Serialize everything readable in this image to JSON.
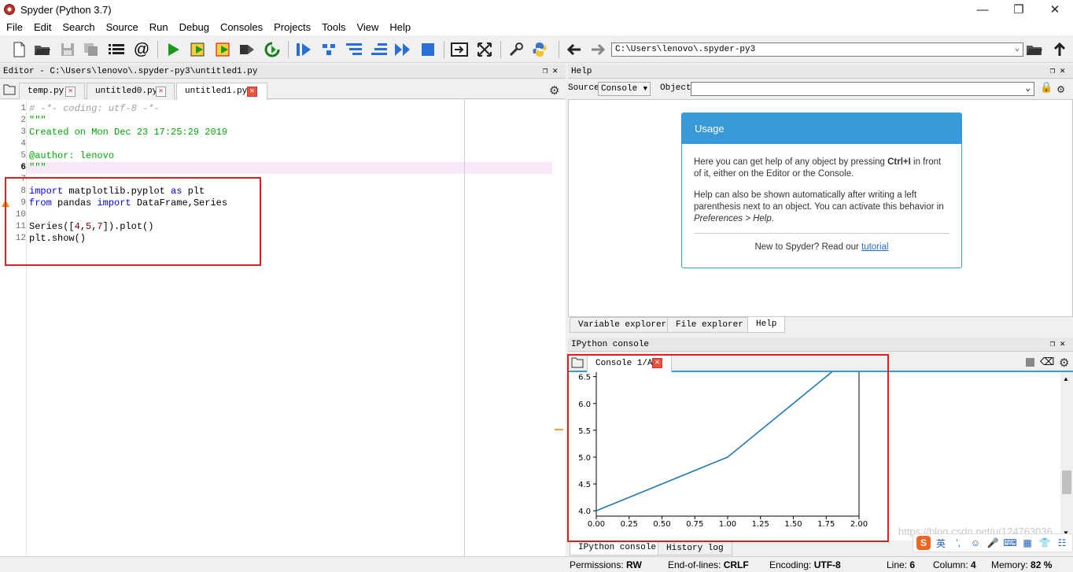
{
  "window": {
    "title": "Spyder (Python 3.7)"
  },
  "menu": [
    "File",
    "Edit",
    "Search",
    "Source",
    "Run",
    "Debug",
    "Consoles",
    "Projects",
    "Tools",
    "View",
    "Help"
  ],
  "toolbar": {
    "working_dir": "C:\\Users\\lenovo\\.spyder-py3"
  },
  "editor": {
    "pane_title": "Editor - C:\\Users\\lenovo\\.spyder-py3\\untitled1.py",
    "tabs": [
      "temp.py",
      "untitled0.py",
      "untitled1.py"
    ],
    "active_tab": "untitled1.py",
    "line_numbers": [
      "1",
      "2",
      "3",
      "4",
      "5",
      "6",
      "7",
      "8",
      "9",
      "10",
      "11",
      "12"
    ],
    "current_line": "6",
    "code": {
      "l1": "# -*- coding: utf-8 -*-",
      "l2": "\"\"\"",
      "l3": "Created on Mon Dec 23 17:25:29 2019",
      "l5": "@author: lenovo",
      "l6": "\"\"\"",
      "l8_kw1": "import",
      "l8_mod": " matplotlib.pyplot ",
      "l8_kw2": "as",
      "l8_rest": " plt",
      "l9_kw1": "from",
      "l9_mod": " pandas ",
      "l9_kw2": "import",
      "l9_rest": " DataFrame,Series",
      "l11_a": "Series([",
      "l11_n1": "4",
      "l11_c1": ",",
      "l11_n2": "5",
      "l11_c2": ",",
      "l11_n3": "7",
      "l11_b": "]).plot()",
      "l12": "plt.show()"
    }
  },
  "help": {
    "pane_title": "Help",
    "source_label": "Source",
    "source_value": "Console",
    "object_label": "Object",
    "usage_title": "Usage",
    "p1a": "Here you can get help of any object by pressing ",
    "p1b": "Ctrl+I",
    "p1c": " in front of it, either on the Editor or the Console.",
    "p2a": "Help can also be shown automatically after writing a left parenthesis next to an object. You can activate this behavior in ",
    "p2b": "Preferences > Help",
    "p2c": ".",
    "new_text": "New to Spyder? Read our ",
    "tutorial_link": "tutorial",
    "tabs": [
      "Variable explorer",
      "File explorer",
      "Help"
    ]
  },
  "console": {
    "pane_title": "IPython console",
    "tab": "Console 1/A",
    "bottom_tabs": [
      "IPython console",
      "History log"
    ],
    "watermark": "https://blog.csdn.net/u/124763036"
  },
  "chart_data": {
    "type": "line",
    "title": "",
    "xlabel": "",
    "ylabel": "",
    "x": [
      0,
      1,
      2
    ],
    "series": [
      {
        "values": [
          4,
          5,
          7
        ],
        "color": "#1f77b4"
      }
    ],
    "xlim": [
      0,
      2
    ],
    "ylim_visible": [
      3.9,
      6.7
    ],
    "x_ticks": [
      "0.00",
      "0.25",
      "0.50",
      "0.75",
      "1.00",
      "1.25",
      "1.50",
      "1.75",
      "2.00"
    ],
    "y_ticks": [
      "4.0",
      "4.5",
      "5.0",
      "5.5",
      "6.0",
      "6.5"
    ],
    "grid": false
  },
  "status": {
    "permissions_label": "Permissions:",
    "permissions": "RW",
    "eol_label": "End-of-lines:",
    "eol": "CRLF",
    "encoding_label": "Encoding:",
    "encoding": "UTF-8",
    "line_label": "Line:",
    "line": "6",
    "column_label": "Column:",
    "column": "4",
    "memory_label": "Memory:",
    "memory": "82 %"
  },
  "ime": {
    "lang": "英"
  },
  "colors": {
    "accent": "#3a9ad9",
    "highlight_box": "#e02020",
    "plot_line": "#1f77b4"
  }
}
